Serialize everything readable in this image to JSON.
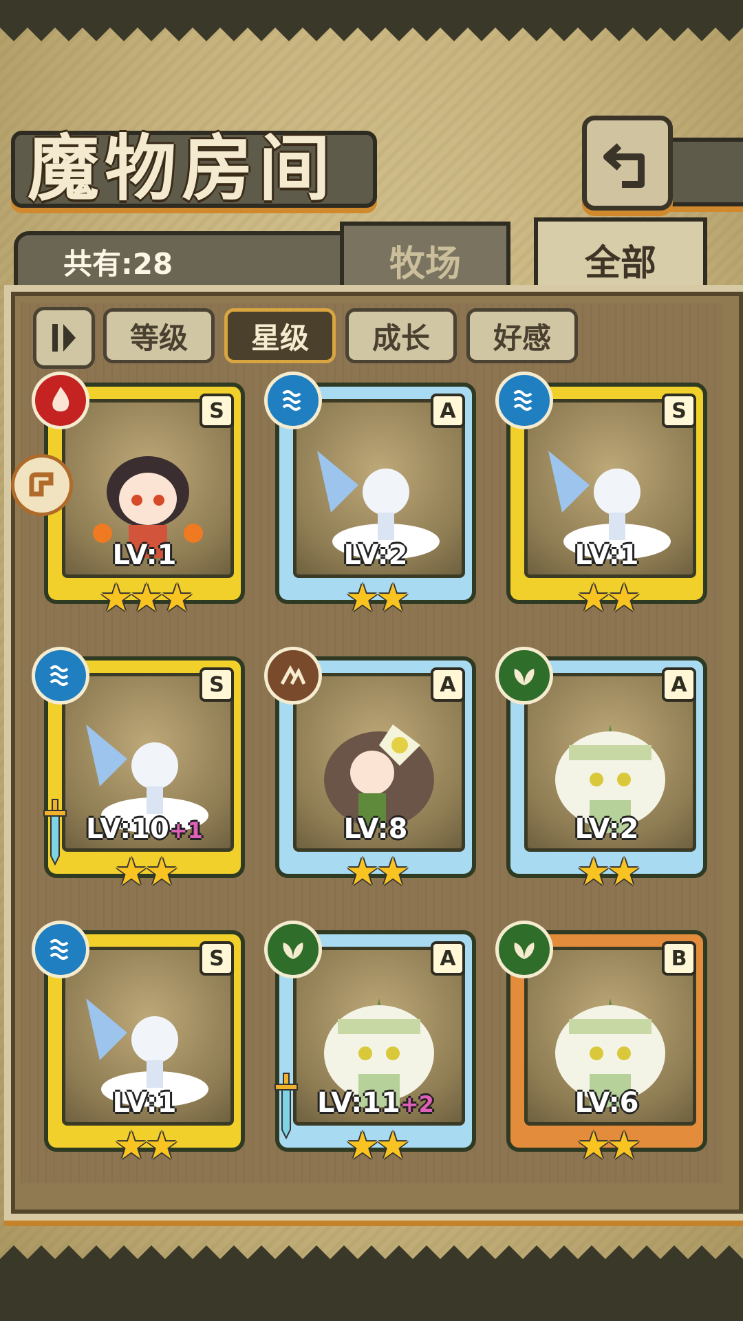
{
  "title": "魔物房间",
  "count_label": "共有:28",
  "tabs": [
    {
      "label": "牧场",
      "active": false
    },
    {
      "label": "全部",
      "active": true
    }
  ],
  "sort_buttons": [
    {
      "label": "等级",
      "active": false
    },
    {
      "label": "星级",
      "active": true
    },
    {
      "label": "成长",
      "active": false
    },
    {
      "label": "好感",
      "active": false
    }
  ],
  "cards": [
    {
      "rank": "S",
      "element": "fire-icon",
      "level": "LV:1",
      "bonus": "",
      "stars": 3,
      "frame": "gold",
      "creature": "horned girl with fire"
    },
    {
      "rank": "A",
      "element": "water-icon",
      "level": "LV:2",
      "bonus": "",
      "stars": 2,
      "frame": "blue",
      "creature": "flower fairy on cloud"
    },
    {
      "rank": "S",
      "element": "water-icon",
      "level": "LV:1",
      "bonus": "",
      "stars": 2,
      "frame": "gold",
      "creature": "flower fairy on cloud"
    },
    {
      "rank": "S",
      "element": "water-icon",
      "level": "LV:10",
      "bonus": "+1",
      "stars": 2,
      "frame": "gold",
      "creature": "flower fairy on cloud"
    },
    {
      "rank": "A",
      "element": "earth-icon",
      "level": "LV:8",
      "bonus": "",
      "stars": 2,
      "frame": "blue",
      "creature": "flower girl"
    },
    {
      "rank": "A",
      "element": "plant-icon",
      "level": "LV:2",
      "bonus": "",
      "stars": 2,
      "frame": "blue",
      "creature": "onion girl"
    },
    {
      "rank": "S",
      "element": "water-icon",
      "level": "LV:1",
      "bonus": "",
      "stars": 2,
      "frame": "gold",
      "creature": "flower fairy on cloud"
    },
    {
      "rank": "A",
      "element": "plant-icon",
      "level": "LV:11",
      "bonus": "+2",
      "stars": 2,
      "frame": "blue",
      "creature": "onion girl"
    },
    {
      "rank": "B",
      "element": "plant-icon",
      "level": "LV:6",
      "bonus": "",
      "stars": 2,
      "frame": "orange",
      "creature": "onion girl"
    }
  ],
  "colors": {
    "gold": "#f1d02c",
    "blue": "#a8dbf2",
    "orange": "#e38d3c",
    "star": "#f9c321",
    "bonus": "#e060b8"
  }
}
